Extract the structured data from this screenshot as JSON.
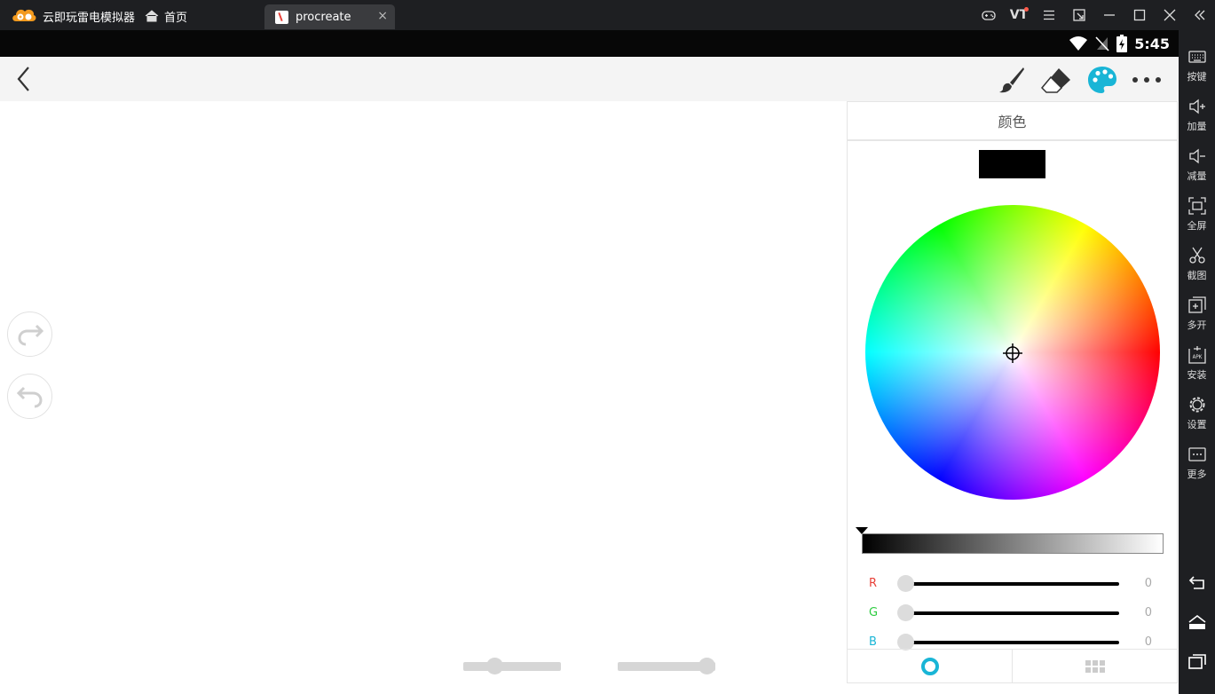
{
  "window": {
    "app_name": "云即玩雷电模拟器",
    "home_tab_label": "首页",
    "active_tab_title": "procreate",
    "tab_close_glyph": "×",
    "vt_label": "VT"
  },
  "status_bar": {
    "time": "5:45"
  },
  "toolbar": {
    "tools": [
      "brush-icon",
      "eraser-icon",
      "palette-icon",
      "more-icon"
    ],
    "accent_color": "#19b5d6"
  },
  "color_panel": {
    "title": "颜色",
    "current_color": "#000000",
    "brightness_value": 0,
    "channels": [
      {
        "label": "R",
        "value": "0",
        "color": "#e8423a"
      },
      {
        "label": "G",
        "value": "0",
        "color": "#2ecc40"
      },
      {
        "label": "B",
        "value": "0",
        "color": "#19b5d6"
      }
    ],
    "tabs": [
      "color-wheel-tab",
      "swatches-tab"
    ]
  },
  "canvas": {
    "size_slider_level": 0.29,
    "opacity_slider_level": 1.0
  },
  "sidebar": {
    "items": [
      {
        "label": "按键",
        "icon": "keyboard-icon"
      },
      {
        "label": "加量",
        "icon": "volume-up-icon"
      },
      {
        "label": "减量",
        "icon": "volume-down-icon"
      },
      {
        "label": "全屏",
        "icon": "fullscreen-icon"
      },
      {
        "label": "截图",
        "icon": "scissors-icon"
      },
      {
        "label": "多开",
        "icon": "multi-open-icon"
      },
      {
        "label": "安装",
        "icon": "apk-install-icon"
      },
      {
        "label": "设置",
        "icon": "gear-icon"
      },
      {
        "label": "更多",
        "icon": "more-icon"
      }
    ]
  }
}
